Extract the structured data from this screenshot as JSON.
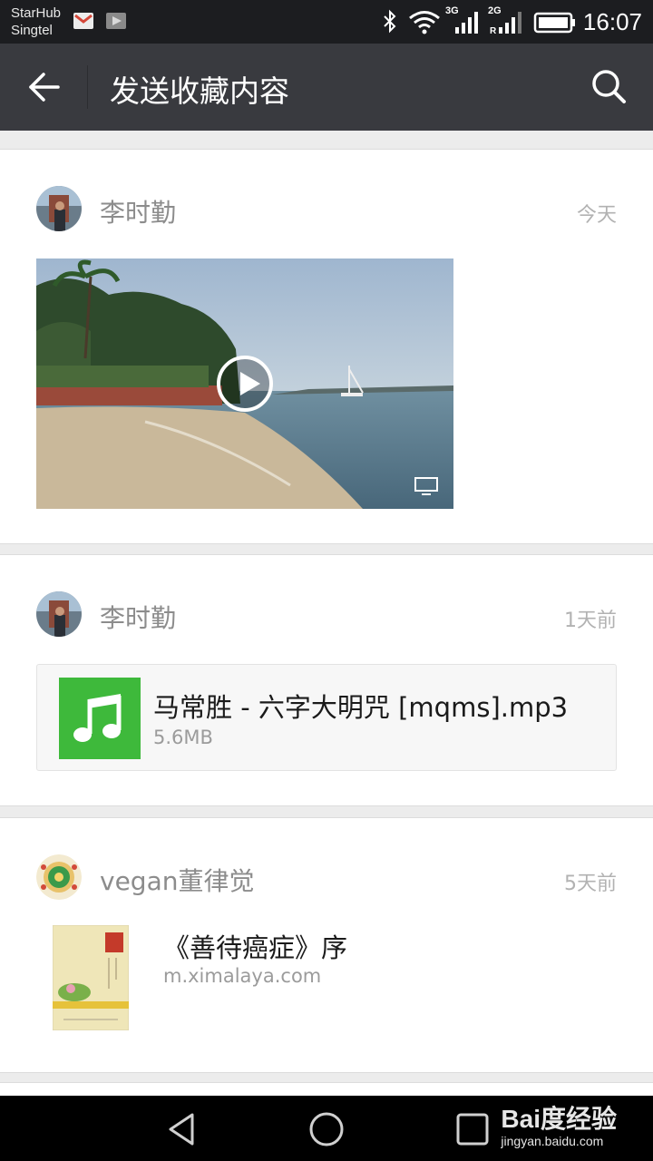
{
  "status_bar": {
    "carrier_1": "StarHub",
    "carrier_2": "Singtel",
    "net_3g": "3G",
    "net_2g": "2G",
    "time": "16:07"
  },
  "header": {
    "title": "发送收藏内容",
    "back_icon": "back-arrow-icon",
    "search_icon": "search-icon"
  },
  "items": [
    {
      "sender": "李时勤",
      "time": "今天",
      "type": "video"
    },
    {
      "sender": "李时勤",
      "time": "1天前",
      "type": "file",
      "file": {
        "name": "马常胜 - 六字大明咒 [mqms].mp3",
        "size": "5.6MB"
      }
    },
    {
      "sender": "vegan董律觉",
      "time": "5天前",
      "type": "link",
      "link": {
        "title": "《善待癌症》序",
        "url": "m.ximalaya.com"
      }
    }
  ],
  "watermark": {
    "brand": "Bai度经验",
    "url": "jingyan.baidu.com"
  },
  "colors": {
    "header": "#393a3f",
    "status_bar": "#1c1d20",
    "music_green": "#3eb93b"
  }
}
